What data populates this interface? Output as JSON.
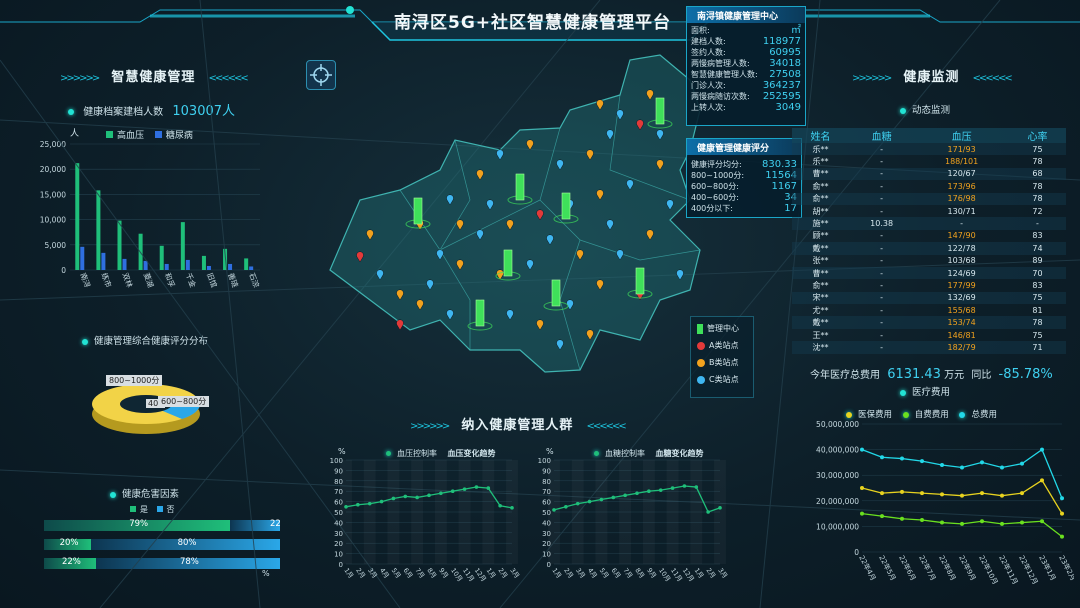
{
  "header": {
    "title": "南浔区5G+社区智慧健康管理平台"
  },
  "left": {
    "section_title": "智慧健康管理",
    "records_label": "健康档案建档人数",
    "records_value": "103007人",
    "bar_chart": {
      "unit": "人",
      "legend": [
        "高血压",
        "糖尿病"
      ]
    },
    "score_dist_title": "健康管理综合健康评分分布",
    "pie_labels": [
      "800~1000分",
      "400",
      "600~800分"
    ],
    "risk_title": "健康危害因素",
    "risk_legend": [
      "是",
      "否"
    ],
    "risk_rows": [
      {
        "yes": 79,
        "yes_label": "79%",
        "no_label": "22"
      },
      {
        "yes": 20,
        "yes_label": "20%",
        "no_label": "80%"
      },
      {
        "yes": 22,
        "yes_label": "22%",
        "no_label": "78%"
      }
    ],
    "risk_axis_unit": "%"
  },
  "center": {
    "map_legend": [
      "管理中心",
      "A类站点",
      "B类站点",
      "C类站点"
    ],
    "population_title": "纳入健康管理人群",
    "bp_legend": [
      "血压控制率",
      "血压变化趋势"
    ],
    "bs_legend": [
      "血糖控制率",
      "血糖变化趋势"
    ],
    "axis_unit": "%"
  },
  "popup_stats": {
    "title": "南浔镇健康管理中心",
    "rows": [
      {
        "k": "面积:",
        "v": "㎡"
      },
      {
        "k": "建档人数:",
        "v": "118977"
      },
      {
        "k": "签约人数:",
        "v": "60995"
      },
      {
        "k": "两慢病管理人数:",
        "v": "34018"
      },
      {
        "k": "智慧健康管理人数:",
        "v": "27508"
      },
      {
        "k": "门诊人次:",
        "v": "364237"
      },
      {
        "k": "两慢病随访次数:",
        "v": "252595"
      },
      {
        "k": "上转人次:",
        "v": "3049"
      }
    ]
  },
  "popup_score": {
    "title": "健康管理健康评分",
    "rows": [
      {
        "k": "健康评分均分:",
        "v": "830.33"
      },
      {
        "k": "800~1000分:",
        "v": "11564"
      },
      {
        "k": "600~800分:",
        "v": "1167"
      },
      {
        "k": "400~600分:",
        "v": "34"
      },
      {
        "k": "400分以下:",
        "v": "17"
      }
    ]
  },
  "right": {
    "section_title": "健康监测",
    "monitor_title": "动态监测",
    "table_headers": [
      "姓名",
      "血糖",
      "血压",
      "心率"
    ],
    "table_rows": [
      [
        "乐**",
        "-",
        "171/93",
        "75"
      ],
      [
        "乐**",
        "-",
        "188/101",
        "78"
      ],
      [
        "曹**",
        "-",
        "120/67",
        "68"
      ],
      [
        "俞**",
        "-",
        "173/96",
        "78"
      ],
      [
        "俞**",
        "-",
        "176/98",
        "78"
      ],
      [
        "胡**",
        "-",
        "130/71",
        "72"
      ],
      [
        "施**",
        "10.38",
        "-",
        "-"
      ],
      [
        "顾**",
        "-",
        "147/90",
        "83"
      ],
      [
        "戴**",
        "-",
        "122/78",
        "74"
      ],
      [
        "张**",
        "-",
        "103/68",
        "89"
      ],
      [
        "曹**",
        "-",
        "124/69",
        "70"
      ],
      [
        "俞**",
        "-",
        "177/99",
        "83"
      ],
      [
        "宋**",
        "-",
        "132/69",
        "75"
      ],
      [
        "尤**",
        "-",
        "155/68",
        "81"
      ],
      [
        "戴**",
        "-",
        "153/74",
        "78"
      ],
      [
        "王**",
        "-",
        "146/81",
        "75"
      ],
      [
        "沈**",
        "-",
        "182/79",
        "71"
      ]
    ],
    "cost_label": "今年医疗总费用",
    "cost_value": "6131.43",
    "cost_unit": "万元",
    "yoy_label": "同比",
    "yoy_value": "-85.78%",
    "med_title": "医疗费用",
    "med_legend": [
      "医保费用",
      "自费费用",
      "总费用"
    ]
  },
  "chart_data": [
    {
      "type": "bar",
      "categories": [
        "南浔",
        "练市",
        "双林",
        "菱湖",
        "和孚",
        "千金",
        "旧馆",
        "善琏",
        "石淙"
      ],
      "series": [
        {
          "name": "高血压",
          "values": [
            21200,
            15800,
            9800,
            7200,
            4800,
            9500,
            2800,
            4200,
            2300
          ]
        },
        {
          "name": "糖尿病",
          "values": [
            4600,
            3400,
            2200,
            1800,
            1200,
            2000,
            800,
            1200,
            700
          ]
        }
      ],
      "ylim": [
        0,
        25000
      ],
      "yticks": [
        "0",
        "5,000",
        "10,000",
        "15,000",
        "20,000",
        "25,000"
      ]
    },
    {
      "type": "line",
      "categories": [
        "1月",
        "2月",
        "3月",
        "4月",
        "5月",
        "6月",
        "7月",
        "8月",
        "9月",
        "10月",
        "11月",
        "12月",
        "1月",
        "2月",
        "3月"
      ],
      "series": [
        {
          "name": "血压控制率",
          "values": [
            55,
            57,
            58,
            60,
            63,
            65,
            64,
            66,
            68,
            70,
            72,
            74,
            73,
            56,
            54
          ]
        }
      ],
      "ylim": [
        0,
        100
      ],
      "yticks": [
        "0",
        "10",
        "20",
        "30",
        "40",
        "50",
        "60",
        "70",
        "80",
        "90",
        "100"
      ]
    },
    {
      "type": "line",
      "categories": [
        "1月",
        "2月",
        "3月",
        "4月",
        "5月",
        "6月",
        "7月",
        "8月",
        "9月",
        "10月",
        "11月",
        "12月",
        "1月",
        "2月",
        "3月"
      ],
      "series": [
        {
          "name": "血糖控制率",
          "values": [
            52,
            55,
            58,
            60,
            62,
            64,
            66,
            68,
            70,
            71,
            73,
            75,
            74,
            50,
            54
          ]
        }
      ],
      "ylim": [
        0,
        100
      ],
      "yticks": [
        "0",
        "10",
        "20",
        "30",
        "40",
        "50",
        "60",
        "70",
        "80",
        "90",
        "100"
      ]
    },
    {
      "type": "line",
      "categories": [
        "22年4月",
        "22年5月",
        "22年6月",
        "22年7月",
        "22年8月",
        "22年9月",
        "22年10月",
        "22年11月",
        "22年12月",
        "23年1月",
        "23年2月"
      ],
      "series": [
        {
          "name": "医保费用",
          "values": [
            25000000,
            23000000,
            23500000,
            23000000,
            22500000,
            22000000,
            23000000,
            22000000,
            23000000,
            28000000,
            15000000
          ]
        },
        {
          "name": "自费费用",
          "values": [
            15000000,
            14000000,
            13000000,
            12500000,
            11500000,
            11000000,
            12000000,
            11000000,
            11500000,
            12000000,
            6000000
          ]
        },
        {
          "name": "总费用",
          "values": [
            40000000,
            37000000,
            36500000,
            35500000,
            34000000,
            33000000,
            35000000,
            33000000,
            34500000,
            40000000,
            21000000
          ]
        }
      ],
      "ylim": [
        0,
        50000000
      ],
      "yticks": [
        "0",
        "10,000,000",
        "20,000,000",
        "30,000,000",
        "40,000,000",
        "50,000,000"
      ]
    },
    {
      "type": "pie",
      "categories": [
        "800~1000分",
        "600~800分",
        "400~600分"
      ],
      "values": [
        11564,
        1167,
        34
      ]
    }
  ]
}
